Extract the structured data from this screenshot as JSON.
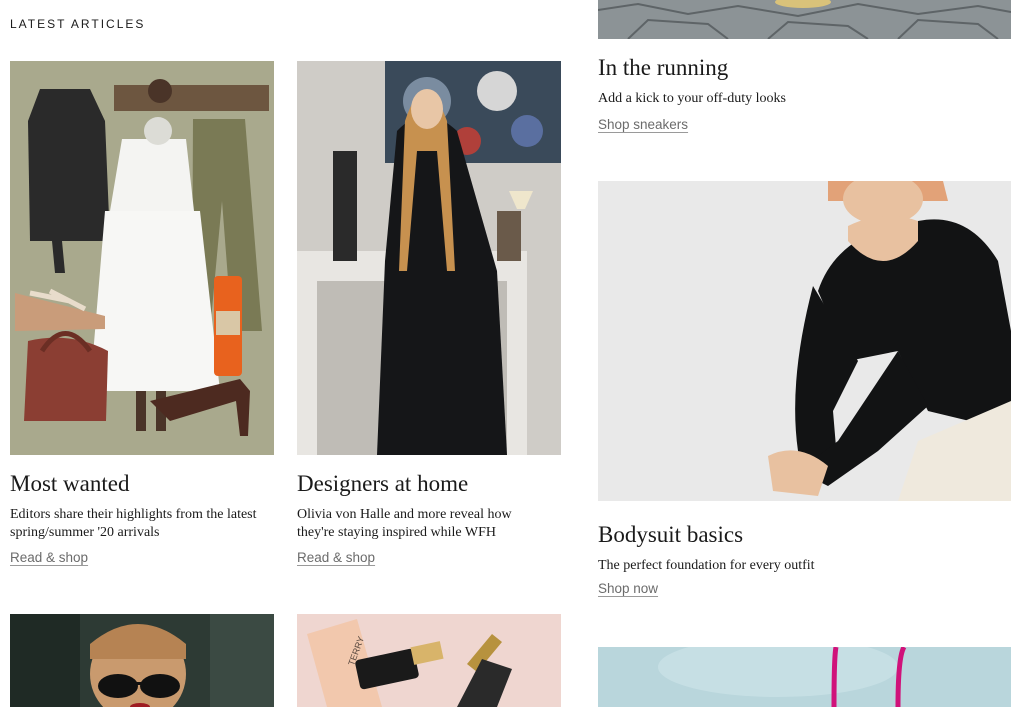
{
  "section": {
    "label": "LATEST ARTICLES"
  },
  "articles": [
    {
      "title": "Most wanted",
      "description": "Editors share their highlights from the latest spring/summer '20 arrivals",
      "link": "Read & shop"
    },
    {
      "title": "Designers at home",
      "description": "Olivia von Halle and more reveal how they're staying inspired while WFH",
      "link": "Read & shop"
    },
    {
      "title": "In the running",
      "description": "Add a kick to your off-duty looks",
      "link": "Shop sneakers"
    },
    {
      "title": "Bodysuit basics",
      "description": "The perfect foundation for every outfit",
      "link": "Shop now"
    }
  ],
  "product_text": {
    "serum_brand": "TERRY"
  },
  "colors": {
    "text": "#1a1a1a",
    "link": "#6b6b6b",
    "collage_bg": "#a9a98d",
    "serum_bg": "#efd6d0",
    "bodysuit_bg": "#e9e9e9"
  }
}
